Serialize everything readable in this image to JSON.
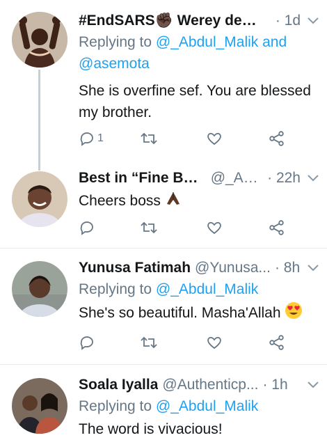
{
  "tweets": [
    {
      "name": "#EndSARS✊🏿 Werey dey ...",
      "handle": "",
      "time": "· 1d",
      "reply_prefix": "Replying to ",
      "reply_users_1": "@_Abdul_Malik and",
      "reply_users_2": "@asemota",
      "text_1": "She is overfine sef. You are blessed",
      "text_2": "my brother.",
      "reply_count": "1"
    },
    {
      "name": "Best in “Fine Boy”",
      "handle": "@_Ab...",
      "time": "· 22h",
      "text_1": "Cheers boss",
      "emoji": "praying-hands"
    },
    {
      "name": "Yunusa Fatimah",
      "handle": "@Yunusa...",
      "time": "· 8h",
      "reply_prefix": "Replying to ",
      "reply_users_1": "@_Abdul_Malik",
      "text_1": "She's so beautiful. Masha'Allah",
      "emoji": "heart-eyes"
    },
    {
      "name": "Soala Iyalla",
      "handle": "@Authenticp...",
      "time": "· 1h",
      "reply_prefix": "Replying to ",
      "reply_users_1": "@_Abdul_Malik",
      "text_1": "The word is vivacious!"
    }
  ],
  "colors": {
    "link": "#1da1f2",
    "muted": "#657786",
    "text": "#14171a",
    "divider": "#e6ecf0"
  }
}
